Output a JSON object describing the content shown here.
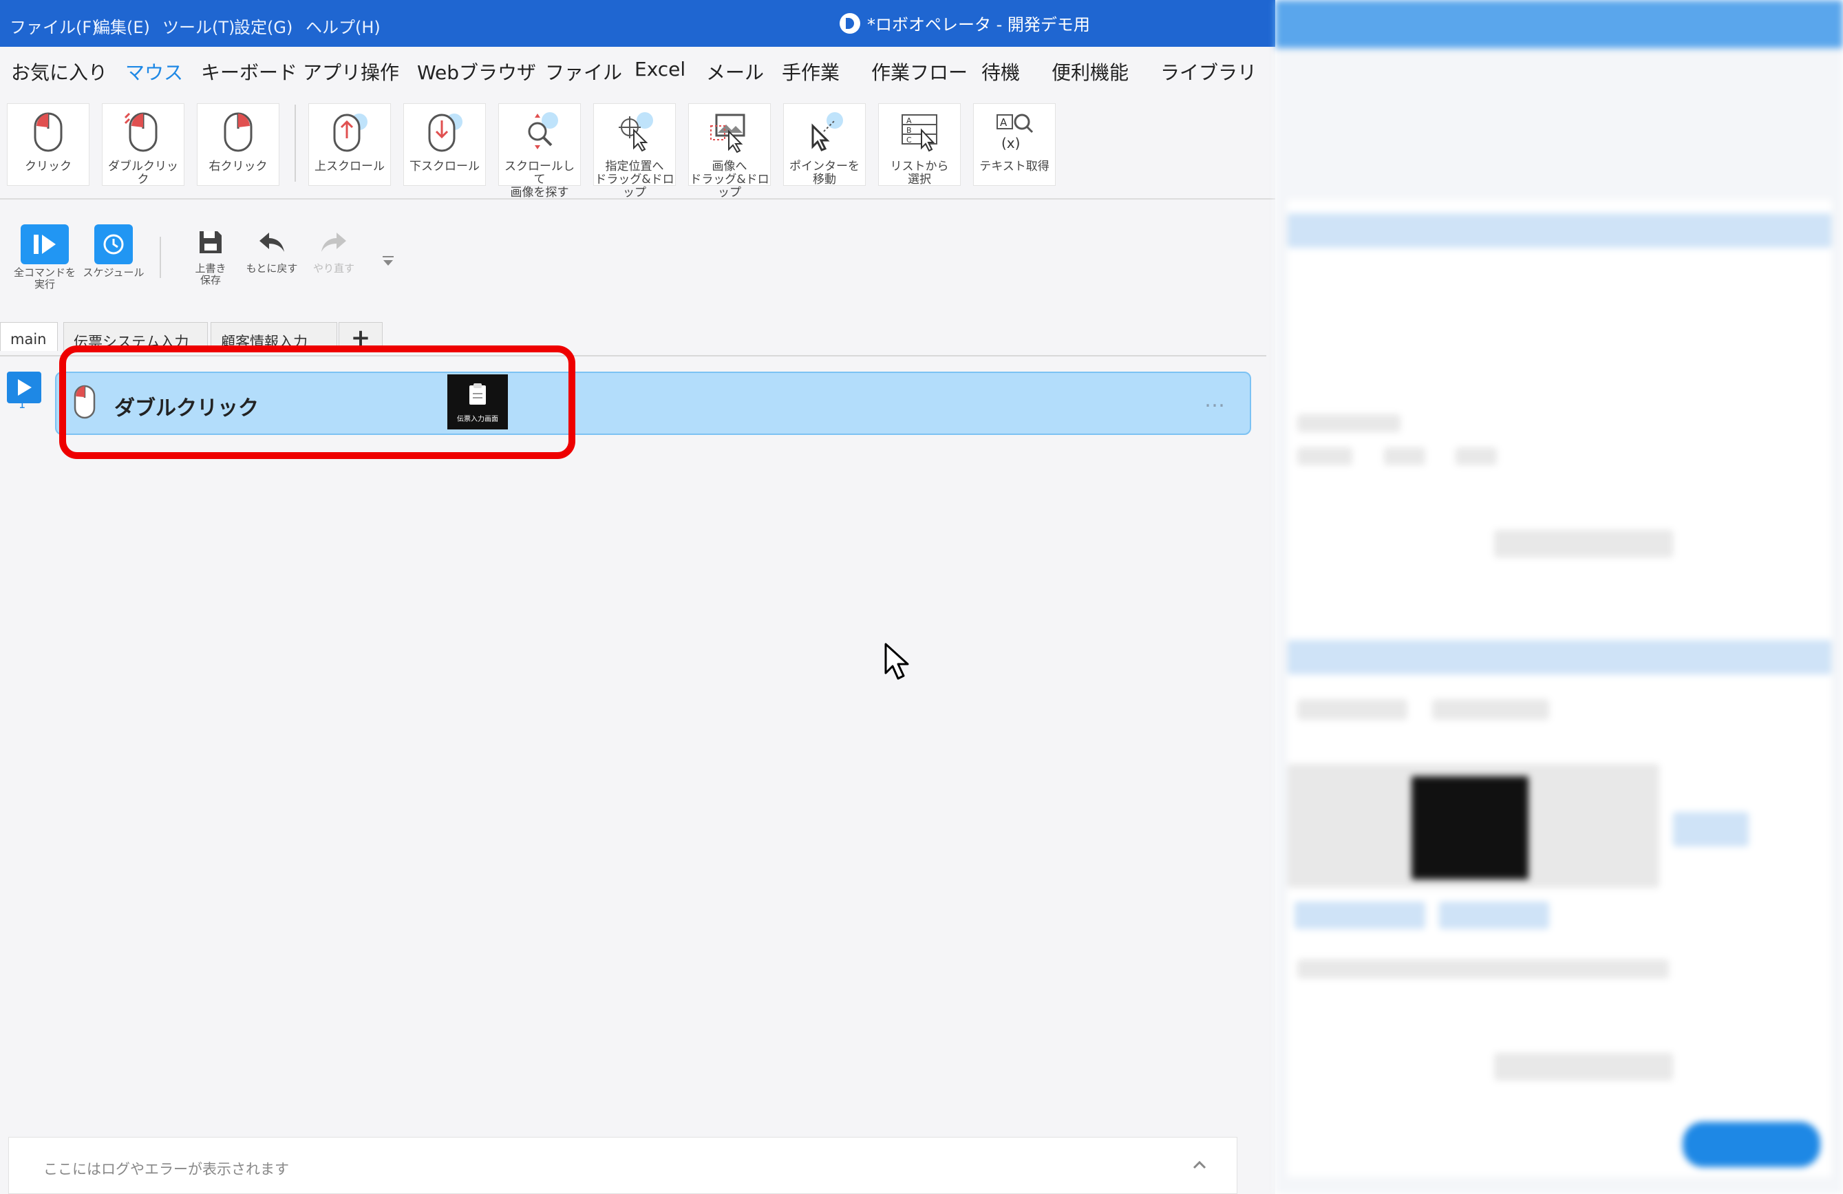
{
  "window": {
    "title": "*ロボオペレータ - 開発デモ用"
  },
  "menu": {
    "file": "ファイル(F)",
    "edit": "編集(E)",
    "tools": "ツール(T)",
    "settings": "設定(G)",
    "help": "ヘルプ(H)"
  },
  "categories": {
    "favorites": "お気に入り",
    "mouse": "マウス",
    "keyboard": "キーボード",
    "app": "アプリ操作",
    "web": "Webブラウザ",
    "file": "ファイル",
    "excel": "Excel",
    "mail": "メール",
    "manual": "手作業",
    "flow": "作業フロー",
    "wait": "待機",
    "util": "便利機能",
    "library": "ライブラリ"
  },
  "ribbon": {
    "click": "クリック",
    "double_click": "ダブルクリック",
    "right_click": "右クリック",
    "scroll_up": "上スクロール",
    "scroll_down": "下スクロール",
    "scroll_find": "スクロールして\n画像を探す",
    "drag_pos": "指定位置へ\nドラッグ&ドロップ",
    "drag_image": "画像へ\nドラッグ&ドロップ",
    "move_pointer": "ポインターを\n移動",
    "select_list": "リストから\n選択",
    "get_text": "テキスト取得"
  },
  "actions": {
    "run_all": "全コマンドを\n実行",
    "schedule": "スケジュール",
    "save": "上書き\n保存",
    "undo": "もとに戻す",
    "redo": "やり直す"
  },
  "tabs": {
    "main": "main",
    "tab2": "伝票システム入力",
    "tab3": "顧客情報入力",
    "add": "+"
  },
  "command": {
    "step": "1",
    "label": "ダブルクリック",
    "thumb_caption": "伝票入力画面",
    "more": "…"
  },
  "log": {
    "placeholder": "ここにはログやエラーが表示されます"
  },
  "colors": {
    "titlebar": "#1f66d1",
    "accent": "#1e88e5",
    "row_bg": "#b3ddfb",
    "highlight": "#ee0000"
  }
}
